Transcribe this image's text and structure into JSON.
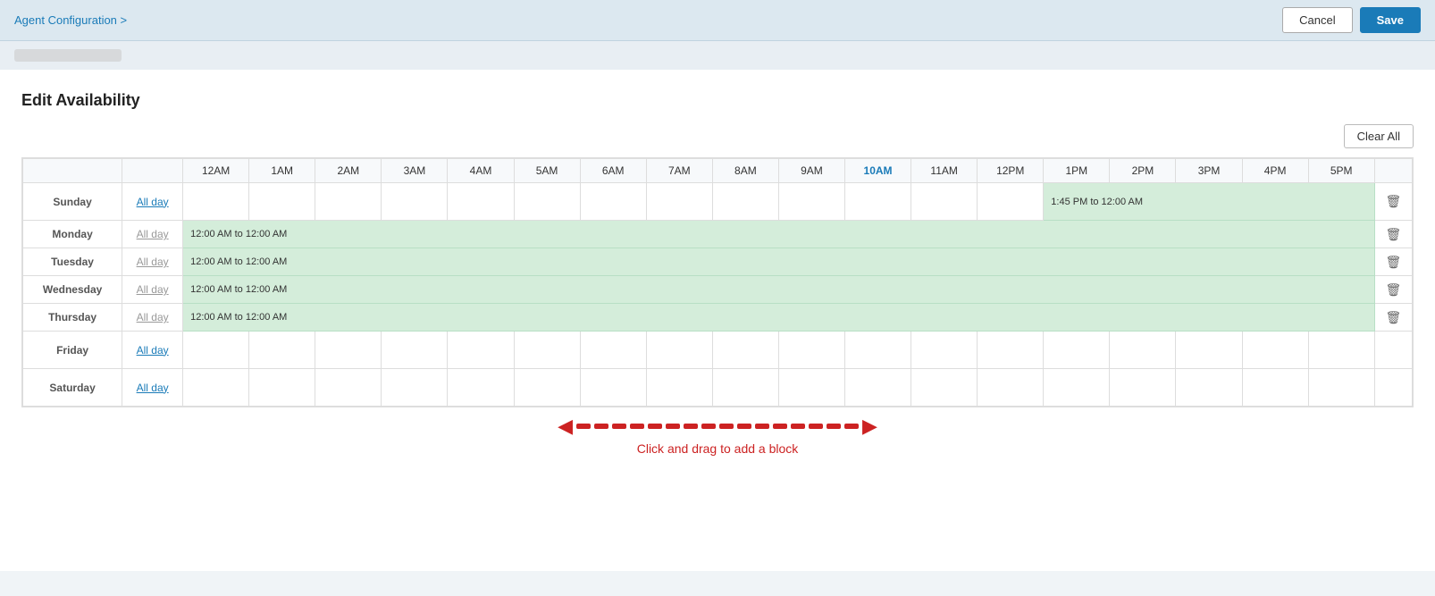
{
  "header": {
    "breadcrumb": "Agent Configuration >",
    "cancel_label": "Cancel",
    "save_label": "Save"
  },
  "page": {
    "title": "Edit Availability",
    "clear_all_label": "Clear All"
  },
  "time_headers": [
    {
      "label": "12AM",
      "highlight": false
    },
    {
      "label": "1AM",
      "highlight": false
    },
    {
      "label": "2AM",
      "highlight": false
    },
    {
      "label": "3AM",
      "highlight": false
    },
    {
      "label": "4AM",
      "highlight": false
    },
    {
      "label": "5AM",
      "highlight": false
    },
    {
      "label": "6AM",
      "highlight": false
    },
    {
      "label": "7AM",
      "highlight": false
    },
    {
      "label": "8AM",
      "highlight": false
    },
    {
      "label": "9AM",
      "highlight": false
    },
    {
      "label": "10AM",
      "highlight": true
    },
    {
      "label": "11AM",
      "highlight": false
    },
    {
      "label": "12PM",
      "highlight": false
    },
    {
      "label": "1PM",
      "highlight": false
    },
    {
      "label": "2PM",
      "highlight": false
    },
    {
      "label": "3PM",
      "highlight": false
    },
    {
      "label": "4PM",
      "highlight": false
    },
    {
      "label": "5PM",
      "highlight": false
    }
  ],
  "days": [
    {
      "name": "Sunday",
      "allday": "All day",
      "allday_active": true,
      "has_block": true,
      "block_start_col": 14,
      "block_label": "1:45 PM to 12:00 AM",
      "has_delete": true
    },
    {
      "name": "Monday",
      "allday": "All day",
      "allday_active": false,
      "has_block": true,
      "block_start_col": 1,
      "block_label": "12:00 AM to 12:00 AM",
      "has_delete": true
    },
    {
      "name": "Tuesday",
      "allday": "All day",
      "allday_active": false,
      "has_block": true,
      "block_start_col": 1,
      "block_label": "12:00 AM to 12:00 AM",
      "has_delete": true
    },
    {
      "name": "Wednesday",
      "allday": "All day",
      "allday_active": false,
      "has_block": true,
      "block_start_col": 1,
      "block_label": "12:00 AM to 12:00 AM",
      "has_delete": true
    },
    {
      "name": "Thursday",
      "allday": "All day",
      "allday_active": false,
      "has_block": true,
      "block_start_col": 1,
      "block_label": "12:00 AM to 12:00 AM",
      "has_delete": true
    },
    {
      "name": "Friday",
      "allday": "All day",
      "allday_active": true,
      "has_block": false,
      "block_label": "",
      "has_delete": false
    },
    {
      "name": "Saturday",
      "allday": "All day",
      "allday_active": true,
      "has_block": false,
      "block_label": "",
      "has_delete": false
    }
  ],
  "drag_hint": "Click and drag to add a block",
  "colors": {
    "accent": "#1a7bb8",
    "block_bg": "#d4edda",
    "block_border": "#b8dfc5",
    "arrow": "#cc2222"
  }
}
